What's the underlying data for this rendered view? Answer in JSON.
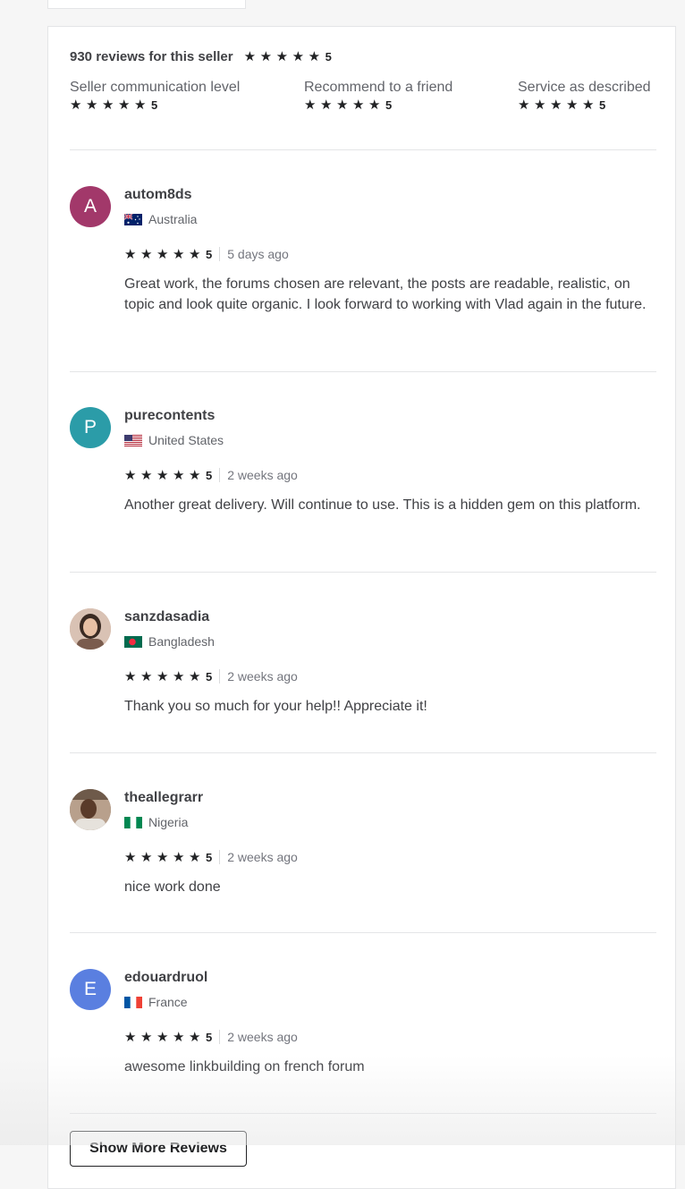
{
  "summary": {
    "title": "930 reviews for this seller",
    "overall_score": "5",
    "criteria": [
      {
        "label": "Seller communication level",
        "score": "5"
      },
      {
        "label": "Recommend to a friend",
        "score": "5"
      },
      {
        "label": "Service as described",
        "score": "5"
      }
    ]
  },
  "reviews": [
    {
      "username": "autom8ds",
      "avatar_letter": "A",
      "avatar_color": "#a2386a",
      "country": "Australia",
      "rating": "5",
      "time": "5 days ago",
      "text": "Great work, the forums chosen are relevant, the posts are readable, realistic, on topic and look quite organic. I look forward to working with Vlad again in the future."
    },
    {
      "username": "purecontents",
      "avatar_letter": "P",
      "avatar_color": "#2b9ca8",
      "country": "United States",
      "rating": "5",
      "time": "2 weeks ago",
      "text": "Another great delivery. Will continue to use. This is a hidden gem on this platform."
    },
    {
      "username": "sanzdasadia",
      "avatar_letter": "",
      "avatar_color": "#c9a58f",
      "country": "Bangladesh",
      "rating": "5",
      "time": "2 weeks ago",
      "text": "Thank you so much for your help!! Appreciate it!"
    },
    {
      "username": "theallegrarr",
      "avatar_letter": "",
      "avatar_color": "#8a7667",
      "country": "Nigeria",
      "rating": "5",
      "time": "2 weeks ago",
      "text": "nice work done"
    },
    {
      "username": "edouardruol",
      "avatar_letter": "E",
      "avatar_color": "#5a7fe0",
      "country": "France",
      "rating": "5",
      "time": "2 weeks ago",
      "text": "awesome linkbuilding on french forum"
    }
  ],
  "show_more_label": "Show More Reviews",
  "icons": {
    "star": "star-icon"
  }
}
